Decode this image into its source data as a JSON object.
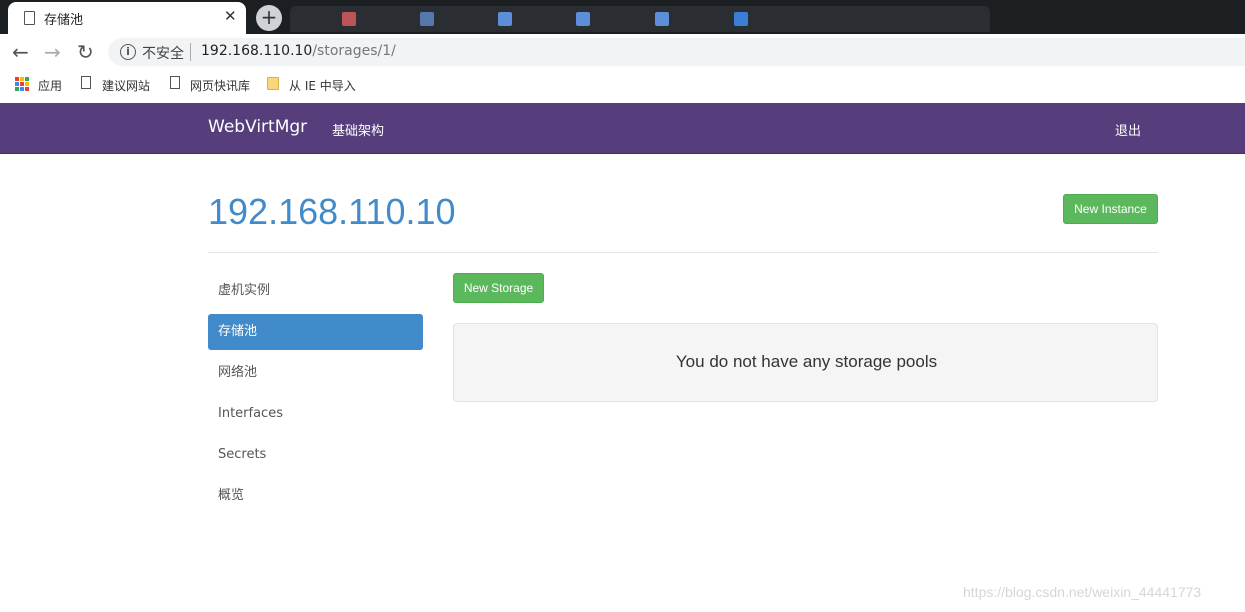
{
  "browser": {
    "tab_title": "存储池",
    "close_glyph": "✕",
    "new_tab_glyph": "+",
    "nav": {
      "back_glyph": "←",
      "forward_glyph": "→",
      "reload_glyph": "↻"
    },
    "info_glyph": "i",
    "security_label": "不安全",
    "url_host": "192.168.110.10",
    "url_path": "/storages/1/",
    "bookmarks": [
      "应用",
      "建议网站",
      "网页快讯库",
      "从 IE 中导入"
    ]
  },
  "navbar": {
    "brand": "WebVirtMgr",
    "infrastructure": "基础架构",
    "logout": "退出",
    "color": "#563d7c"
  },
  "page": {
    "title": "192.168.110.10",
    "new_instance": "New Instance",
    "new_storage": "New Storage",
    "empty_message": "You do not have any storage pools"
  },
  "sidebar": {
    "items": [
      {
        "label": "虚机实例",
        "active": false
      },
      {
        "label": "存储池",
        "active": true
      },
      {
        "label": "网络池",
        "active": false
      },
      {
        "label": "Interfaces",
        "active": false
      },
      {
        "label": "Secrets",
        "active": false
      },
      {
        "label": "概览",
        "active": false
      }
    ]
  },
  "watermark": "https://blog.csdn.net/weixin_44441773",
  "colors": {
    "accent": "#428bca",
    "success": "#5cb85c"
  }
}
